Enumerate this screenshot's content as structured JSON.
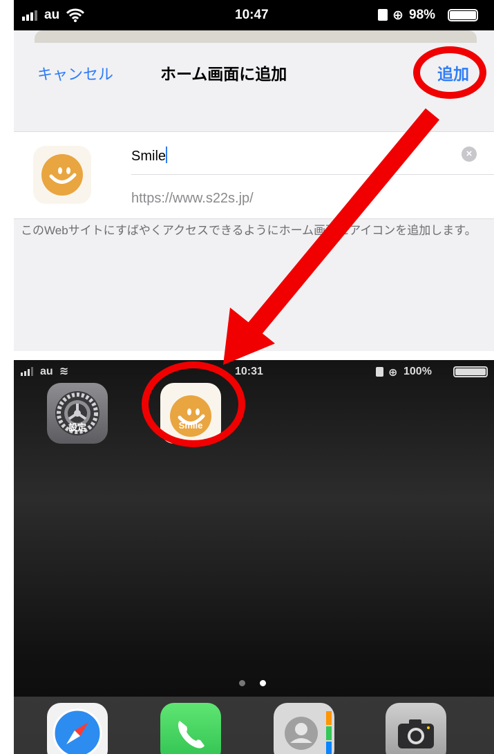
{
  "top_screen": {
    "status": {
      "carrier": "au",
      "time": "10:47",
      "battery": "98%"
    },
    "nav": {
      "cancel": "キャンセル",
      "title": "ホーム画面に追加",
      "add": "追加"
    },
    "form": {
      "name_value": "Smile",
      "url": "https://www.s22s.jp/"
    },
    "description": "このWebサイトにすばやくアクセスできるようにホーム画面にアイコンを追加します。",
    "icon": "smiley-icon"
  },
  "bottom_screen": {
    "status": {
      "carrier": "au",
      "time": "10:31",
      "battery": "100%"
    },
    "apps": [
      {
        "label": "設定",
        "icon": "settings-gear-icon"
      },
      {
        "label": "Smile",
        "icon": "smiley-icon"
      }
    ],
    "page_dots": {
      "count": 2,
      "active": 2
    },
    "dock": [
      "safari-icon",
      "phone-icon",
      "contacts-icon",
      "camera-icon"
    ]
  },
  "colors": {
    "accent": "#2f7cf6",
    "annotation": "#f00000",
    "smile": "#e9a540"
  }
}
